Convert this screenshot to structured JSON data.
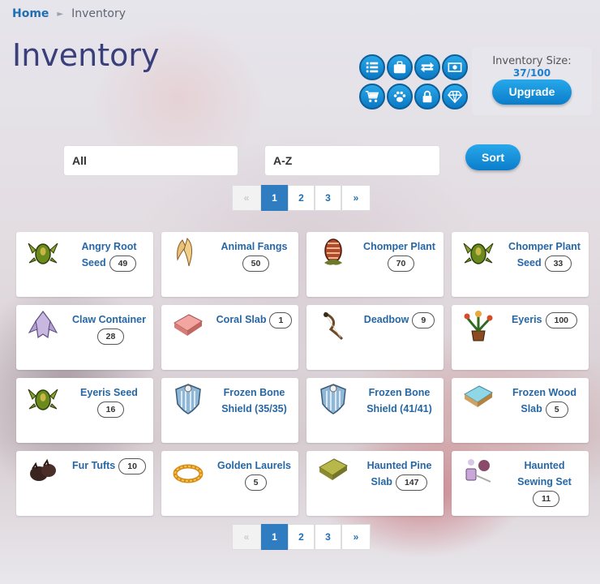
{
  "breadcrumb": {
    "home": "Home",
    "separator": "►",
    "current": "Inventory"
  },
  "page_title": "Inventory",
  "quick_icons": [
    {
      "name": "list-icon"
    },
    {
      "name": "suitcase-icon"
    },
    {
      "name": "transfer-icon"
    },
    {
      "name": "money-icon"
    },
    {
      "name": "cart-icon"
    },
    {
      "name": "paw-icon"
    },
    {
      "name": "lock-icon"
    },
    {
      "name": "diamond-icon"
    }
  ],
  "inventory_size": {
    "label": "Inventory Size:",
    "count": "37/100",
    "upgrade_label": "Upgrade"
  },
  "filters": {
    "category": "All",
    "order": "A-Z",
    "sort_label": "Sort"
  },
  "pagination": {
    "prev": "«",
    "pages": [
      "1",
      "2",
      "3"
    ],
    "active": "1",
    "next": "»"
  },
  "items": [
    {
      "name_line1": "Angry Root",
      "name_line2": "Seed",
      "qty": "49",
      "qty_inline": true,
      "icon": "seed-icon"
    },
    {
      "name_line1": "Animal Fangs",
      "name_line2": "",
      "qty": "50",
      "qty_inline": false,
      "icon": "fangs-icon"
    },
    {
      "name_line1": "Chomper Plant",
      "name_line2": "",
      "qty": "70",
      "qty_inline": false,
      "icon": "egg-plant-icon"
    },
    {
      "name_line1": "Chomper Plant",
      "name_line2": "Seed",
      "qty": "33",
      "qty_inline": true,
      "icon": "seed-icon"
    },
    {
      "name_line1": "Claw Container",
      "name_line2": "",
      "qty": "28",
      "qty_inline": false,
      "icon": "claw-container-icon"
    },
    {
      "name_line1": "Coral Slab",
      "name_line2": "",
      "qty": "1",
      "qty_inline": true,
      "icon": "slab-icon"
    },
    {
      "name_line1": "Deadbow",
      "name_line2": "",
      "qty": "9",
      "qty_inline": true,
      "icon": "bow-icon"
    },
    {
      "name_line1": "Eyeris",
      "name_line2": "",
      "qty": "100",
      "qty_inline": true,
      "icon": "potted-plant-icon"
    },
    {
      "name_line1": "Eyeris Seed",
      "name_line2": "",
      "qty": "16",
      "qty_inline": false,
      "icon": "seed-icon"
    },
    {
      "name_line1": "Frozen Bone",
      "name_line2": "Shield (35/35)",
      "qty": "",
      "qty_inline": false,
      "icon": "shield-icon"
    },
    {
      "name_line1": "Frozen Bone",
      "name_line2": "Shield (41/41)",
      "qty": "",
      "qty_inline": false,
      "icon": "shield-icon"
    },
    {
      "name_line1": "Frozen Wood",
      "name_line2": "Slab",
      "qty": "5",
      "qty_inline": true,
      "icon": "ice-slab-icon"
    },
    {
      "name_line1": "Fur Tufts",
      "name_line2": "",
      "qty": "10",
      "qty_inline": true,
      "icon": "fur-icon"
    },
    {
      "name_line1": "Golden Laurels",
      "name_line2": "",
      "qty": "5",
      "qty_inline": false,
      "icon": "laurels-icon"
    },
    {
      "name_line1": "Haunted Pine",
      "name_line2": "Slab",
      "qty": "147",
      "qty_inline": true,
      "icon": "pine-slab-icon"
    },
    {
      "name_line1": "Haunted",
      "name_line2": "Sewing Set",
      "qty": "11",
      "qty_inline": false,
      "icon": "sewing-set-icon"
    }
  ]
}
